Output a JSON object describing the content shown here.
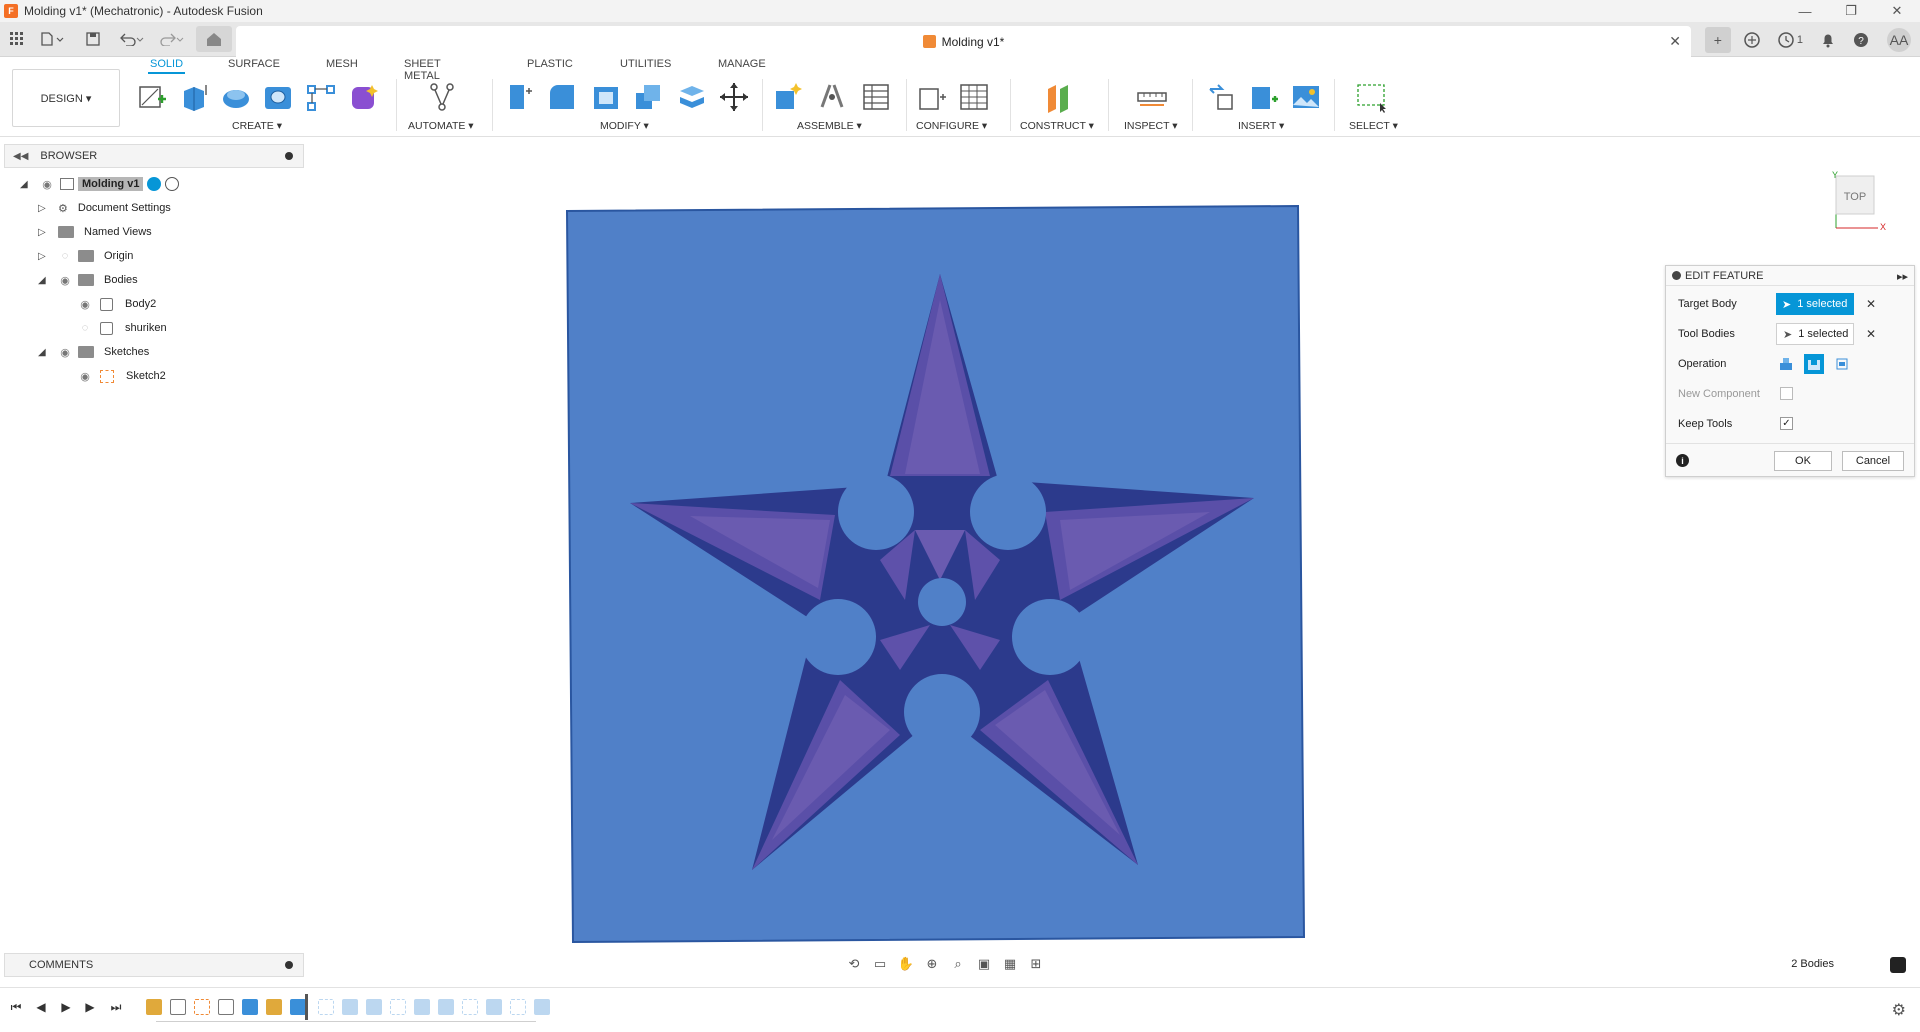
{
  "window": {
    "title": "Molding v1* (Mechatronic) - Autodesk Fusion",
    "controls": [
      "—",
      "❐",
      "✕"
    ]
  },
  "doc_tab": {
    "title": "Molding v1*",
    "close": "✕"
  },
  "user": {
    "initials": "AA",
    "notifications_count": "1"
  },
  "ribbon": {
    "workspace": "DESIGN ▾",
    "tabs": [
      "SOLID",
      "SURFACE",
      "MESH",
      "SHEET METAL",
      "PLASTIC",
      "UTILITIES",
      "MANAGE"
    ],
    "active_tab": "SOLID",
    "groups": {
      "create": "CREATE ▾",
      "automate": "AUTOMATE ▾",
      "modify": "MODIFY ▾",
      "assemble": "ASSEMBLE ▾",
      "configure": "CONFIGURE ▾",
      "construct": "CONSTRUCT ▾",
      "inspect": "INSPECT ▾",
      "insert": "INSERT ▾",
      "select": "SELECT ▾"
    }
  },
  "browser": {
    "title": "BROWSER",
    "root": "Molding v1",
    "items": [
      {
        "label": "Document Settings"
      },
      {
        "label": "Named Views"
      },
      {
        "label": "Origin"
      },
      {
        "label": "Bodies"
      },
      {
        "label": "Body2"
      },
      {
        "label": "shuriken"
      },
      {
        "label": "Sketches"
      },
      {
        "label": "Sketch2"
      }
    ]
  },
  "viewcube": {
    "face": "TOP",
    "axis_x": "X",
    "axis_y": "Y"
  },
  "edit_feature": {
    "title": "EDIT FEATURE",
    "target_body_label": "Target Body",
    "target_body_value": "1 selected",
    "tool_bodies_label": "Tool Bodies",
    "tool_bodies_value": "1 selected",
    "operation_label": "Operation",
    "new_component_label": "New Component",
    "keep_tools_label": "Keep Tools",
    "keep_tools_checked": true,
    "ok_label": "OK",
    "cancel_label": "Cancel"
  },
  "comments": {
    "title": "COMMENTS"
  },
  "status": {
    "bodies": "2 Bodies"
  },
  "colors": {
    "accent": "#0696d7",
    "mold_block": "#5080c8",
    "star_face": "#6a5bb0",
    "star_dark": "#2c3a8c"
  }
}
